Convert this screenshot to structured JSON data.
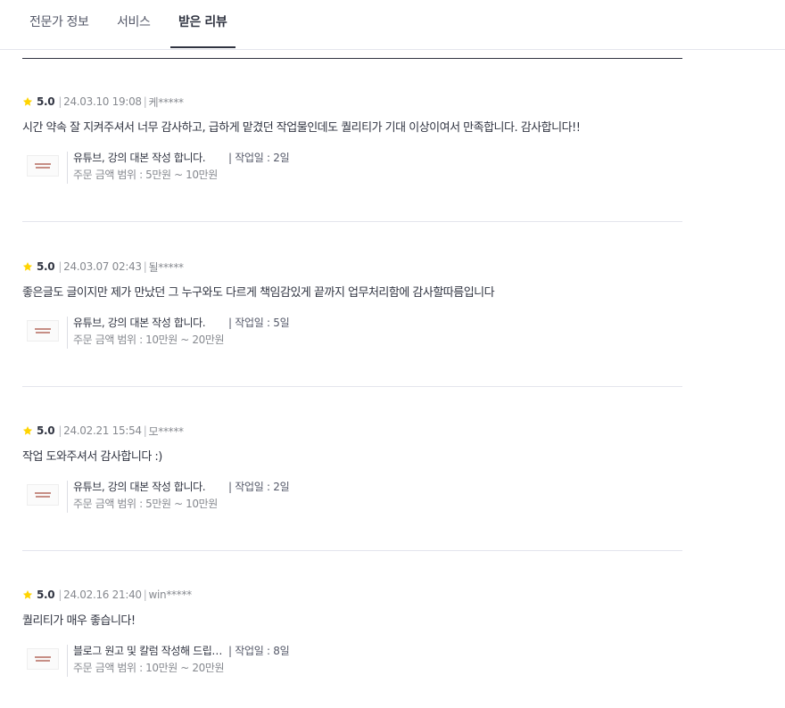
{
  "tabs": [
    {
      "label": "전문가 정보"
    },
    {
      "label": "서비스"
    },
    {
      "label": "받은 리뷰"
    }
  ],
  "colors": {
    "star": "#ffd400",
    "text": "#303441",
    "muted": "#86898f",
    "accent_underline": "#303441"
  },
  "reviews": [
    {
      "score": "5.0",
      "date": "24.03.10 19:08",
      "user": "케*****",
      "text": "시간 약속 잘 지켜주셔서 너무 감사하고, 급하게 맡겼던 작업물인데도 퀄리티가 기대 이상이여서 만족합니다. 감사합니다!!",
      "service_title": "유튜브, 강의 대본 작성 합니다.",
      "work_days": "| 작업일 : 2일",
      "price_range": "주문 금액 범위 : 5만원 ~ 10만원"
    },
    {
      "score": "5.0",
      "date": "24.03.07 02:43",
      "user": "될*****",
      "text": "좋은글도 글이지만 제가 만났던 그 누구와도 다르게 책임감있게 끝까지 업무처리함에 감사할따름입니다",
      "service_title": "유튜브, 강의 대본 작성 합니다.",
      "work_days": "| 작업일 : 5일",
      "price_range": "주문 금액 범위 : 10만원 ~ 20만원"
    },
    {
      "score": "5.0",
      "date": "24.02.21 15:54",
      "user": "모*****",
      "text": "작업 도와주셔서 감사합니다 :)",
      "service_title": "유튜브, 강의 대본 작성 합니다.",
      "work_days": "| 작업일 : 2일",
      "price_range": "주문 금액 범위 : 5만원 ~ 10만원"
    },
    {
      "score": "5.0",
      "date": "24.02.16 21:40",
      "user": "win*****",
      "text": "퀄리티가 매우 좋습니다!",
      "service_title": "블로그 원고 및 칼럼 작성해 드립니다.",
      "work_days": "| 작업일 : 8일",
      "price_range": "주문 금액 범위 : 10만원 ~ 20만원"
    }
  ]
}
